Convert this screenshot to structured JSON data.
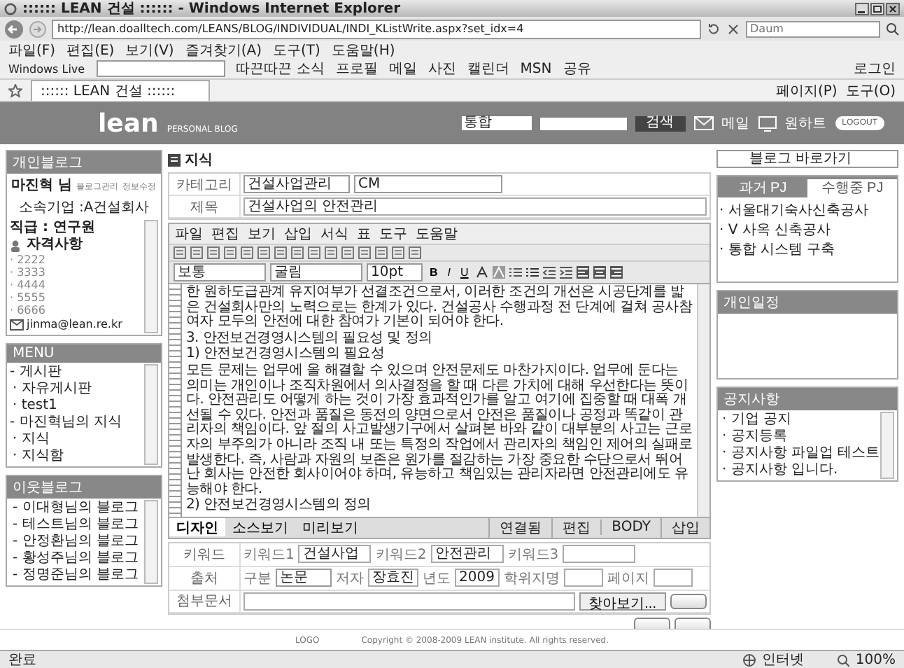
{
  "window": {
    "title": ":::::: LEAN 건설 :::::: - Windows Internet Explorer"
  },
  "address_bar": {
    "url": "http://lean.doalltech.com/LEANS/BLOG/INDIVIDUAL/INDI_KListWrite.aspx?set_idx=4",
    "search_placeholder": "Daum"
  },
  "menu_bar": [
    "파일(F)",
    "편집(E)",
    "보기(V)",
    "즐겨찾기(A)",
    "도구(T)",
    "도움말(H)"
  ],
  "links_bar": {
    "brand": "Windows Live",
    "links": [
      "따끈따끈 소식",
      "프로필",
      "메일",
      "사진",
      "캘린더",
      "MSN",
      "공유"
    ],
    "login": "로그인"
  },
  "tab": {
    "title": ":::::: LEAN 건설 ::::::"
  },
  "command_bar": [
    "페이지(P)",
    "도구(O)"
  ],
  "header": {
    "logo": "lean",
    "tagline": "PERSONAL BLOG",
    "search_scope": "통합",
    "search_button": "검색",
    "links": [
      "메일",
      "원하트"
    ],
    "logout": "LOGOUT"
  },
  "profile": {
    "title": "개인블로그",
    "name": "마진혁 님",
    "actions": [
      "블로그관리",
      "정보수정"
    ],
    "company": "소속기업 :A건설회사",
    "position": "직급 : 연구원",
    "qual_title": "자격사항",
    "quals": [
      "· 2222",
      "· 3333",
      "· 4444",
      "· 5555",
      "· 6666"
    ],
    "email": "jinma@lean.re.kr"
  },
  "menu": {
    "title": "MENU",
    "items": [
      {
        "label": "- 게시판",
        "children": [
          {
            "label": "· 자유게시판"
          },
          {
            "label": "· test1"
          }
        ]
      },
      {
        "label": "- 마진혁님의 지식",
        "children": [
          {
            "label": "· 지식"
          },
          {
            "label": "· 지식함"
          }
        ]
      }
    ]
  },
  "neighbors": {
    "title": "이웃블로그",
    "items": [
      "- 이대형님의 블로그",
      "- 테스트님의 블로그",
      "- 안정환님의 블로그",
      "- 황성주님의 블로그",
      "- 정명준님의 블로그"
    ]
  },
  "page_title": "지식",
  "form": {
    "category_label": "카테고리",
    "category": "건설사업관리",
    "subcategory": "CM",
    "title_label": "제목",
    "title": "건설사업의 안전관리"
  },
  "editor": {
    "menu": [
      "파일",
      "편집",
      "보기",
      "삽입",
      "서식",
      "표",
      "도구",
      "도움말"
    ],
    "style": "보통",
    "font": "굴림",
    "size": "10pt",
    "format_buttons": [
      "B",
      "I",
      "U"
    ],
    "paragraphs": [
      "한 원하도급관계 유지여부가 선결조건으로서, 이러한 조건의 개선은 시공단계를 밟은 건설회사만의 노력으로는 한계가 있다. 건설공사 수행과정 전 단계에 걸쳐 공사참여자 모두의 안전에 대한 참여가 기본이 되어야 한다.",
      "3. 안전보건경영시스템의 필요성 및 정의",
      "1) 안전보건경영시스템의 필요성",
      "모든 문제는 업무에 올 해결할 수 있으며 안전문제도 마찬가지이다. 업무에 둔다는 의미는 개인이나 조직차원에서 의사결정을 할 때 다른 가치에 대해 우선한다는 뜻이다. 안전관리도 어떻게 하는 것이 가장 효과적인가를 알고 여기에 집중할 때 대폭 개선될 수 있다. 안전과 품질은 동전의 양면으로서 안전은 품질이나 공정과 똑같이 관리자의 책임이다. 앞 절의 사고발생기구에서 살펴본 바와 같이 대부분의 사고는 근로자의 부주의가 아니라 조직 내 또는 특정의 작업에서 관리자의 책임인 제어의 실패로 발생한다. 즉, 사람과 자원의 보존은 원가를 절감하는 가장 중요한 수단으로서 뛰어난 회사는 안전한 회사이어야 하며, 유능하고 책임있는 관리자라면 안전관리에도 유능해야 한다.",
      "2) 안전보건경영시스템의 정의"
    ],
    "tabs": [
      {
        "label": "디자인",
        "selected": true
      },
      {
        "label": "소스보기",
        "selected": false
      },
      {
        "label": "미리보기",
        "selected": false
      }
    ],
    "status": [
      "연결됨",
      "편집",
      "BODY",
      "삽입"
    ]
  },
  "keywords": {
    "label": "키워드",
    "items": [
      {
        "label": "키워드1",
        "value": "건설사업"
      },
      {
        "label": "키워드2",
        "value": "안전관리"
      },
      {
        "label": "키워드3"
      }
    ]
  },
  "source": {
    "label": "출처",
    "type_label": "구분",
    "type": "논문",
    "author_label": "저자",
    "author": "장효진",
    "year_label": "년도",
    "year": "2009",
    "degree_label": "학위지명",
    "page_label": "페이지"
  },
  "attachment": {
    "label": "첨부문서",
    "browse": "찾아보기..."
  },
  "bookmark_select": "블로그 바로가기",
  "projects": {
    "tabs": [
      {
        "label": "과거 PJ",
        "selected": false
      },
      {
        "label": "수행중 PJ",
        "selected": true
      }
    ],
    "items": [
      "· 서울대기숙사신축공사",
      "· V 사옥 신축공사",
      "· 통합 시스템 구축"
    ]
  },
  "schedule": {
    "title": "개인일정"
  },
  "notices": {
    "title": "공지사항",
    "items": [
      "· 기업 공지",
      "· 공지등록",
      "· 공지사항 파일업 테스트",
      "· 공지사항 입니다."
    ]
  },
  "footer": {
    "logo": "LOGO",
    "copyright": "Copyright © 2008-2009 LEAN institute. All rights reserved."
  },
  "status_bar": {
    "status": "완료",
    "zone": "인터넷",
    "zoom": "100%"
  }
}
